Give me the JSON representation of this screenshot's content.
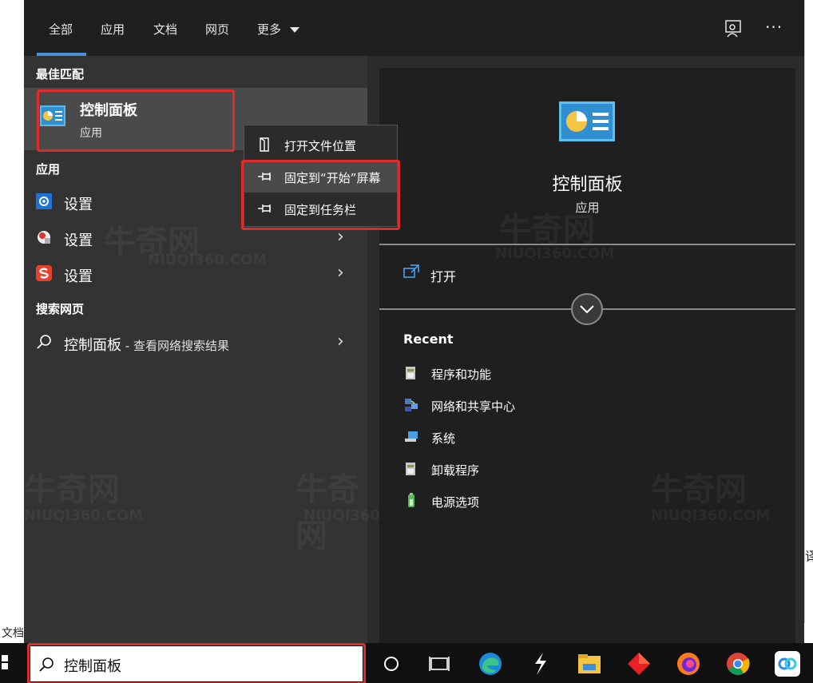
{
  "tabs": [
    "全部",
    "应用",
    "文档",
    "网页",
    "更多"
  ],
  "more_dots": "···",
  "best_match": {
    "heading": "最佳匹配",
    "title": "控制面板",
    "subtitle": "应用"
  },
  "apps": {
    "heading": "应用",
    "items": [
      {
        "label": "设置",
        "icon": "gear-icon"
      },
      {
        "label": "设置",
        "icon": "settings-app-icon"
      },
      {
        "label": "设置",
        "icon": "sogou-icon"
      }
    ]
  },
  "web": {
    "heading": "搜索网页",
    "query": "控制面板",
    "suffix": " - 查看网络搜索结果"
  },
  "context_menu": [
    {
      "label": "打开文件位置",
      "icon": "file-location-icon"
    },
    {
      "label": "固定到“开始”屏幕",
      "icon": "pin-icon"
    },
    {
      "label": "固定到任务栏",
      "icon": "pin-icon"
    }
  ],
  "detail": {
    "title": "控制面板",
    "subtitle": "应用",
    "open_label": "打开",
    "recent_heading": "Recent",
    "recent": [
      "程序和功能",
      "网络和共享中心",
      "系统",
      "卸载程序",
      "电源选项"
    ]
  },
  "search": {
    "value": "控制面板"
  },
  "background": {
    "left_text": "文档",
    "right_char": "译"
  },
  "watermark": {
    "brand": "牛奇网",
    "domain": "NIUQI360.COM"
  },
  "colors": {
    "highlight": "#e02b2b",
    "accent": "#4a90d9"
  }
}
